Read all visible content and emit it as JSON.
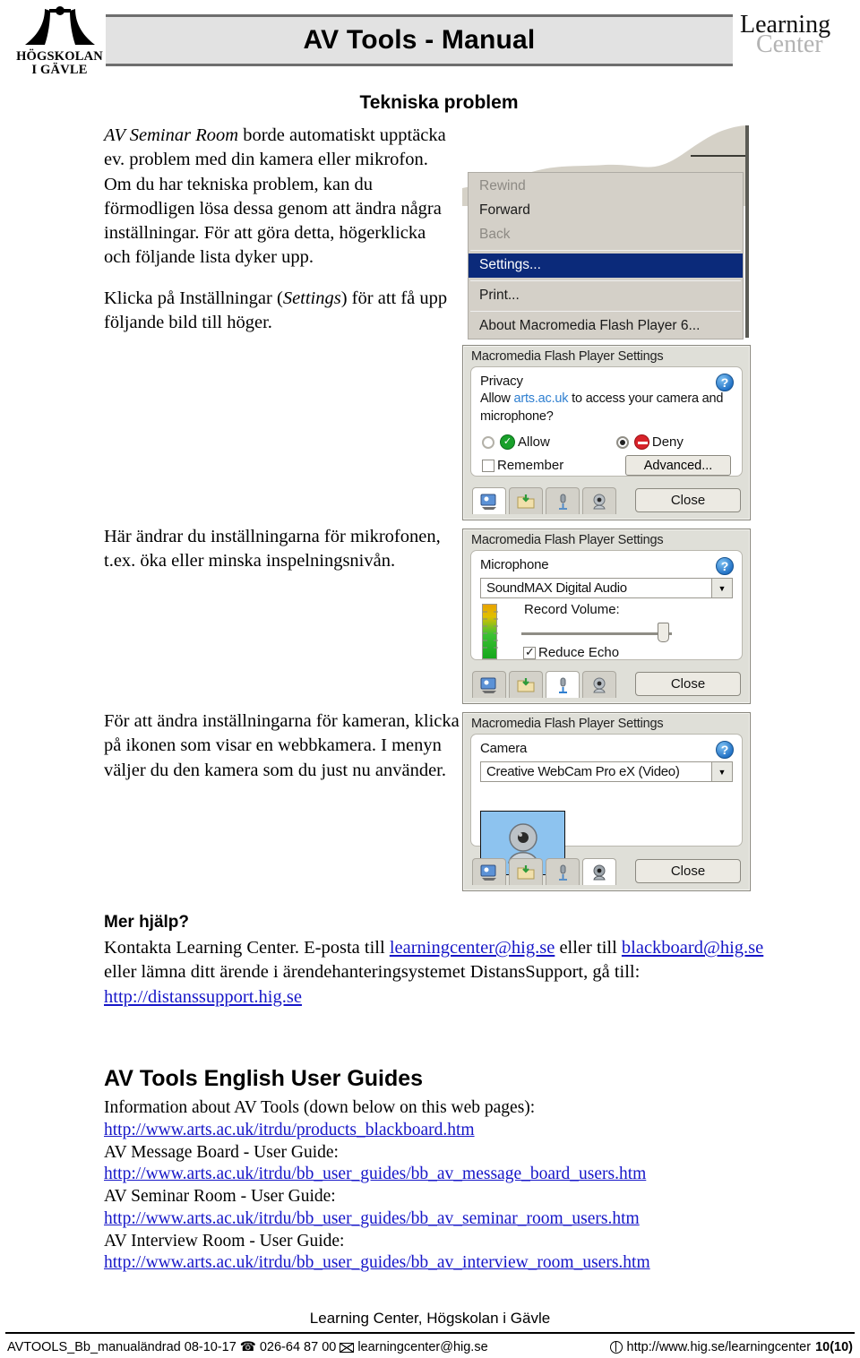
{
  "header": {
    "institution_line1": "HÖGSKOLAN",
    "institution_line2": "I GÄVLE",
    "title": "AV Tools - Manual",
    "lc_line1": "Learning",
    "lc_line2": "Center"
  },
  "section": {
    "heading": "Tekniska problem"
  },
  "body": {
    "intro_italic": "AV Seminar Room",
    "intro_rest": " borde automatiskt upptäcka ev. problem med din kamera eller mikrofon. Om du har tekniska problem, kan du förmodligen lösa dessa genom att ändra några inställningar. För att göra detta, högerklicka och följande lista dyker upp.",
    "settings_pre": "Klicka på Inställningar (",
    "settings_italic": "Settings",
    "settings_post": ") för att få upp följande bild till höger.",
    "mic_para": "Här ändrar du inställningarna för mikrofonen, t.ex. öka eller minska inspelningsnivån.",
    "cam_para": "För att ändra inställningarna för kameran, klicka på ikonen som visar en webbkamera. I menyn väljer du den kamera som du just nu använder."
  },
  "context_menu": {
    "items": [
      {
        "label": "Rewind",
        "state": "disabled"
      },
      {
        "label": "Forward",
        "state": "normal"
      },
      {
        "label": "Back",
        "state": "disabled"
      },
      {
        "label": "Settings...",
        "state": "selected"
      },
      {
        "label": "Print...",
        "state": "normal"
      },
      {
        "label": "About Macromedia Flash Player 6...",
        "state": "normal"
      }
    ],
    "highlight_color": "#0b2a7a"
  },
  "dialog_privacy": {
    "title": "Macromedia Flash Player Settings",
    "panel_label": "Privacy",
    "question_pre": "Allow ",
    "question_link": "arts.ac.uk",
    "question_post": " to access your camera and microphone?",
    "allow_label": "Allow",
    "deny_label": "Deny",
    "remember_label": "Remember",
    "advanced_label": "Advanced...",
    "close_label": "Close",
    "selected_option": "Deny",
    "remember_checked": false,
    "active_tab": "display",
    "help_glyph": "?"
  },
  "dialog_microphone": {
    "title": "Macromedia Flash Player Settings",
    "panel_label": "Microphone",
    "device": "SoundMAX Digital Audio",
    "record_volume_label": "Record Volume:",
    "reduce_echo_label": "Reduce Echo",
    "reduce_echo_checked": true,
    "close_label": "Close",
    "active_tab": "microphone",
    "help_glyph": "?"
  },
  "dialog_camera": {
    "title": "Macromedia Flash Player Settings",
    "panel_label": "Camera",
    "device": "Creative WebCam Pro eX (Video)",
    "close_label": "Close",
    "active_tab": "camera",
    "help_glyph": "?"
  },
  "help": {
    "heading": "Mer hjälp?",
    "line1_pre": "Kontakta Learning Center. E-posta till ",
    "link_learningcenter": "learningcenter@hig.se",
    "line1_mid": " eller till ",
    "link_blackboard": "blackboard@hig.se",
    "line2_rest": " eller lämna ditt ärende i ärendehanteringsystemet DistansSupport, gå till: ",
    "link_distanssupport": "http://distanssupport.hig.se"
  },
  "guides": {
    "heading": "AV Tools English User Guides",
    "intro": "Information about AV Tools (down below on this web pages):",
    "entries": [
      {
        "label": "",
        "url": "http://www.arts.ac.uk/itrdu/products_blackboard.htm"
      },
      {
        "label": "AV Message Board - User Guide:",
        "url": "http://www.arts.ac.uk/itrdu/bb_user_guides/bb_av_message_board_users.htm"
      },
      {
        "label": "AV Seminar Room - User Guide:",
        "url": "http://www.arts.ac.uk/itrdu/bb_user_guides/bb_av_seminar_room_users.htm"
      },
      {
        "label": "AV Interview Room - User Guide:",
        "url": "http://www.arts.ac.uk/itrdu/bb_user_guides/bb_av_interview_room_users.htm"
      }
    ]
  },
  "footer": {
    "center": "Learning Center, Högskolan i Gävle",
    "doc_id": "AVTOOLS_Bb_manualändrad 08-10-17",
    "phone": "026-64 87 00",
    "email": "learningcenter@hig.se",
    "web": "http://www.hig.se/learningcenter",
    "page": "10(10)"
  }
}
